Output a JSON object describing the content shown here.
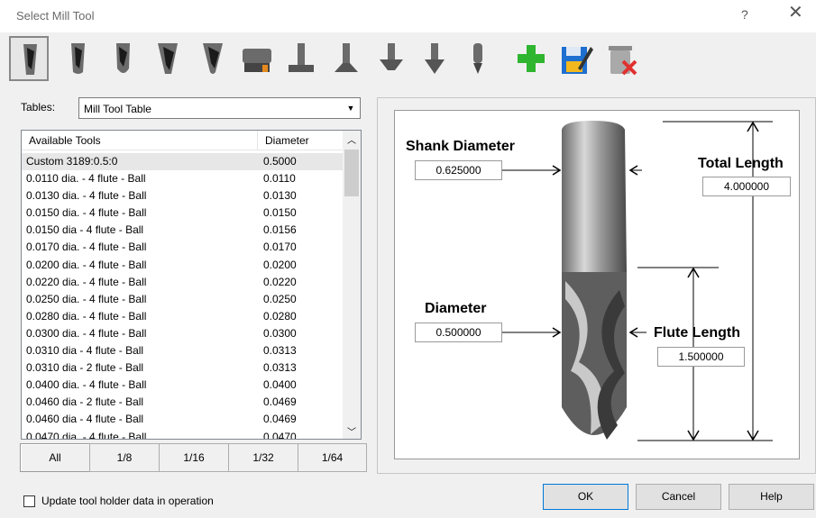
{
  "window": {
    "title": "Select Mill Tool",
    "help_glyph": "?",
    "close_glyph": "✕"
  },
  "toolbar": {
    "buttons": [
      {
        "name": "flat-endmill-icon",
        "selected": true
      },
      {
        "name": "bull-endmill-icon"
      },
      {
        "name": "ball-endmill-icon"
      },
      {
        "name": "taper-endmill-icon"
      },
      {
        "name": "taper-ball-endmill-icon"
      },
      {
        "name": "face-mill-icon"
      },
      {
        "name": "t-slot-cutter-icon"
      },
      {
        "name": "dovetail-cutter-icon"
      },
      {
        "name": "undercut-cutter-icon"
      },
      {
        "name": "chamfer-tool-icon"
      },
      {
        "name": "engraving-tool-icon"
      },
      {
        "name": "add-tool-icon"
      },
      {
        "name": "edit-tool-icon"
      },
      {
        "name": "delete-tool-icon"
      }
    ]
  },
  "tables": {
    "label": "Tables:",
    "selected": "Mill Tool Table"
  },
  "tool_list": {
    "columns": [
      "Available Tools",
      "Diameter"
    ],
    "rows": [
      {
        "name": "Custom 3189:0.5:0",
        "diameter": "0.5000",
        "selected": true
      },
      {
        "name": "0.0110 dia. - 4 flute - Ball",
        "diameter": "0.0110"
      },
      {
        "name": "0.0130 dia. - 4 flute - Ball",
        "diameter": "0.0130"
      },
      {
        "name": "0.0150 dia. - 4 flute - Ball",
        "diameter": "0.0150"
      },
      {
        "name": "0.0150 dia - 4 flute - Ball",
        "diameter": "0.0156"
      },
      {
        "name": "0.0170 dia. - 4 flute - Ball",
        "diameter": "0.0170"
      },
      {
        "name": "0.0200 dia. - 4 flute - Ball",
        "diameter": "0.0200"
      },
      {
        "name": "0.0220 dia. - 4 flute - Ball",
        "diameter": "0.0220"
      },
      {
        "name": "0.0250 dia. - 4 flute - Ball",
        "diameter": "0.0250"
      },
      {
        "name": "0.0280 dia. - 4 flute - Ball",
        "diameter": "0.0280"
      },
      {
        "name": "0.0300 dia. - 4 flute - Ball",
        "diameter": "0.0300"
      },
      {
        "name": "0.0310 dia - 4 flute - Ball",
        "diameter": "0.0313"
      },
      {
        "name": "0.0310 dia - 2 flute - Ball",
        "diameter": "0.0313"
      },
      {
        "name": "0.0400 dia. - 4 flute - Ball",
        "diameter": "0.0400"
      },
      {
        "name": "0.0460 dia - 2 flute - Ball",
        "diameter": "0.0469"
      },
      {
        "name": "0.0460 dia - 4 flute - Ball",
        "diameter": "0.0469"
      },
      {
        "name": "0.0470 dia. - 4 flute - Ball",
        "diameter": "0.0470"
      }
    ]
  },
  "filter_tabs": [
    "All",
    "1/8",
    "1/16",
    "1/32",
    "1/64"
  ],
  "checkbox": {
    "label": "Update tool holder data in operation",
    "checked": false
  },
  "diagram": {
    "shank_diameter": {
      "label": "Shank Diameter",
      "value": "0.625000"
    },
    "total_length": {
      "label": "Total Length",
      "value": "4.000000"
    },
    "diameter": {
      "label": "Diameter",
      "value": "0.500000"
    },
    "flute_length": {
      "label": "Flute Length",
      "value": "1.500000"
    }
  },
  "buttons": {
    "ok": "OK",
    "cancel": "Cancel",
    "help": "Help"
  },
  "colors": {
    "accent": "#0078d7",
    "add_green": "#2fb52f",
    "delete_red": "#e0312f",
    "edit_blue": "#1e6fd0",
    "edit_yellow": "#f2b81e"
  }
}
